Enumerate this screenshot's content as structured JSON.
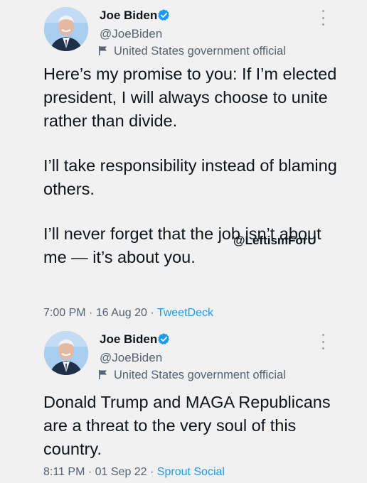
{
  "watermark": "@LeftismForU",
  "colors": {
    "background": "#f1f1f1",
    "verified_badge": "#1d9bf0",
    "source_link": "#1d9bf0",
    "secondary_text": "#566370"
  },
  "tweets": [
    {
      "author": {
        "name": "Joe Biden",
        "handle": "@JoeBiden",
        "label": "United States government official",
        "label_icon": "flag-icon",
        "verified_icon": "verified-badge-icon"
      },
      "paragraphs": [
        "Here’s my promise to you: If I’m elected president, I will always choose to unite rather than divide.",
        "I’ll take responsibility instead of blaming others.",
        "I’ll never forget that the job isn’t about me — it’s about you."
      ],
      "time": "7:00 PM",
      "date": "16 Aug 20",
      "source": "TweetDeck",
      "separator": " · "
    },
    {
      "author": {
        "name": "Joe Biden",
        "handle": "@JoeBiden",
        "label": "United States government official",
        "label_icon": "flag-icon",
        "verified_icon": "verified-badge-icon"
      },
      "paragraphs": [
        "Donald Trump and MAGA Republicans are a threat to the very soul of this country."
      ],
      "time": "8:11 PM",
      "date": "01 Sep 22",
      "source": "Sprout Social",
      "separator": " · "
    }
  ]
}
